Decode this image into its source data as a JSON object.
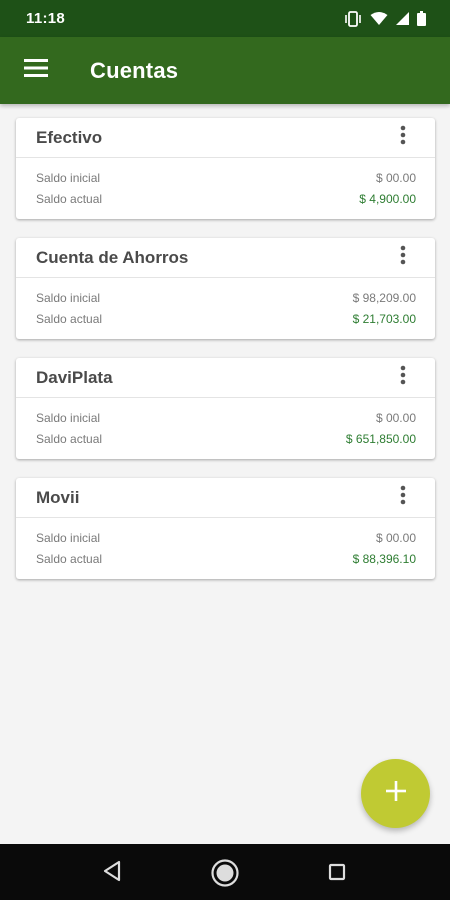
{
  "status_bar": {
    "time": "11:18",
    "icons": [
      "vibrate-icon",
      "wifi-icon",
      "signal-icon",
      "battery-icon"
    ]
  },
  "app_bar": {
    "title": "Cuentas",
    "menu_icon": "menu-icon",
    "color": "#33691e"
  },
  "accounts": [
    {
      "name": "Efectivo",
      "initial_label": "Saldo inicial",
      "initial_value": "$  00.00",
      "current_label": "Saldo actual",
      "current_value": "$  4,900.00"
    },
    {
      "name": "Cuenta de Ahorros",
      "initial_label": "Saldo inicial",
      "initial_value": "$  98,209.00",
      "current_label": "Saldo actual",
      "current_value": "$  21,703.00"
    },
    {
      "name": "DaviPlata",
      "initial_label": "Saldo inicial",
      "initial_value": "$  00.00",
      "current_label": "Saldo actual",
      "current_value": "$  651,850.00"
    },
    {
      "name": "Movii",
      "initial_label": "Saldo inicial",
      "initial_value": "$  00.00",
      "current_label": "Saldo actual",
      "current_value": "$  88,396.10"
    }
  ],
  "fab": {
    "icon": "plus-icon",
    "color": "#c0ca33"
  },
  "nav_bar": {
    "icons": [
      "back-icon",
      "home-icon",
      "recents-icon"
    ]
  }
}
